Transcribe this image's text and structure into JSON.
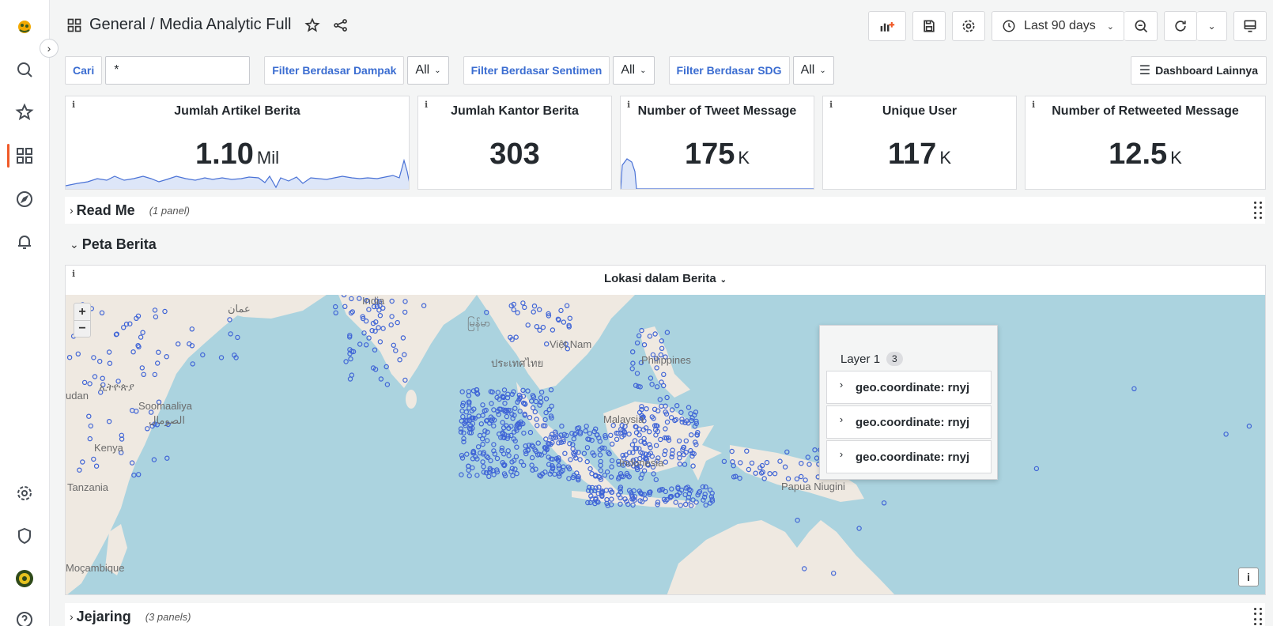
{
  "nav": {
    "items": [
      "logo",
      "search",
      "starred",
      "dashboards",
      "explore",
      "alerting",
      "configuration",
      "server-admin",
      "profile",
      "help"
    ]
  },
  "header": {
    "folder": "General",
    "separator": "/",
    "title": "Media Analytic Full",
    "time_range": "Last 90 days"
  },
  "filters": {
    "search_label": "Cari",
    "search_value": "*",
    "impact_label": "Filter Berdasar Dampak",
    "impact_value": "All",
    "sentiment_label": "Filter Berdasar Sentimen",
    "sentiment_value": "All",
    "sdg_label": "Filter Berdasar SDG",
    "sdg_value": "All",
    "more_dashboards": "Dashboard Lainnya"
  },
  "stats": [
    {
      "title": "Jumlah Artikel Berita",
      "value": "1.10",
      "unit": "Mil"
    },
    {
      "title": "Jumlah Kantor Berita",
      "value": "303",
      "unit": ""
    },
    {
      "title": "Number of Tweet Message",
      "value": "175",
      "unit": "K"
    },
    {
      "title": "Unique User",
      "value": "117",
      "unit": "K"
    },
    {
      "title": "Number of Retweeted Message",
      "value": "12.5",
      "unit": "K"
    }
  ],
  "rows": {
    "readme": {
      "title": "Read Me",
      "count": "(1 panel)"
    },
    "peta": {
      "title": "Peta Berita"
    },
    "jejaring": {
      "title": "Jejaring",
      "count": "(3 panels)"
    }
  },
  "map": {
    "panel_title": "Lokasi dalam Berita",
    "zoom_in": "+",
    "zoom_out": "−",
    "attribution": "i",
    "labels": {
      "india": "India",
      "vietnam": "Việt Nam",
      "philippines": "Philippines",
      "malaysia": "Malaysia",
      "indonesia": "Indonesia",
      "papua": "Papua Niugini",
      "somalia": "Soomaaliya",
      "somalia_ar": "الصومال",
      "kenya": "Kenya",
      "tanzania": "Tanzania",
      "mozambique": "Moçambique",
      "sudan": "udan",
      "ethiopia": "ኢትዮጵያ",
      "oman": "عمان",
      "myanmar": "မြန်မာ",
      "thailand": "ประเทศไทย"
    }
  },
  "tooltip": {
    "layer": "Layer 1",
    "layer_count": "3",
    "items": [
      "geo.coordinate: rnyj",
      "geo.coordinate: rnyj",
      "geo.coordinate: rnyj"
    ]
  },
  "colors": {
    "accent": "#3b6dd1",
    "nav_active": "#f05a28",
    "ocean": "#abd3df",
    "land": "#efe9e1",
    "marker": "#3f64d6"
  }
}
